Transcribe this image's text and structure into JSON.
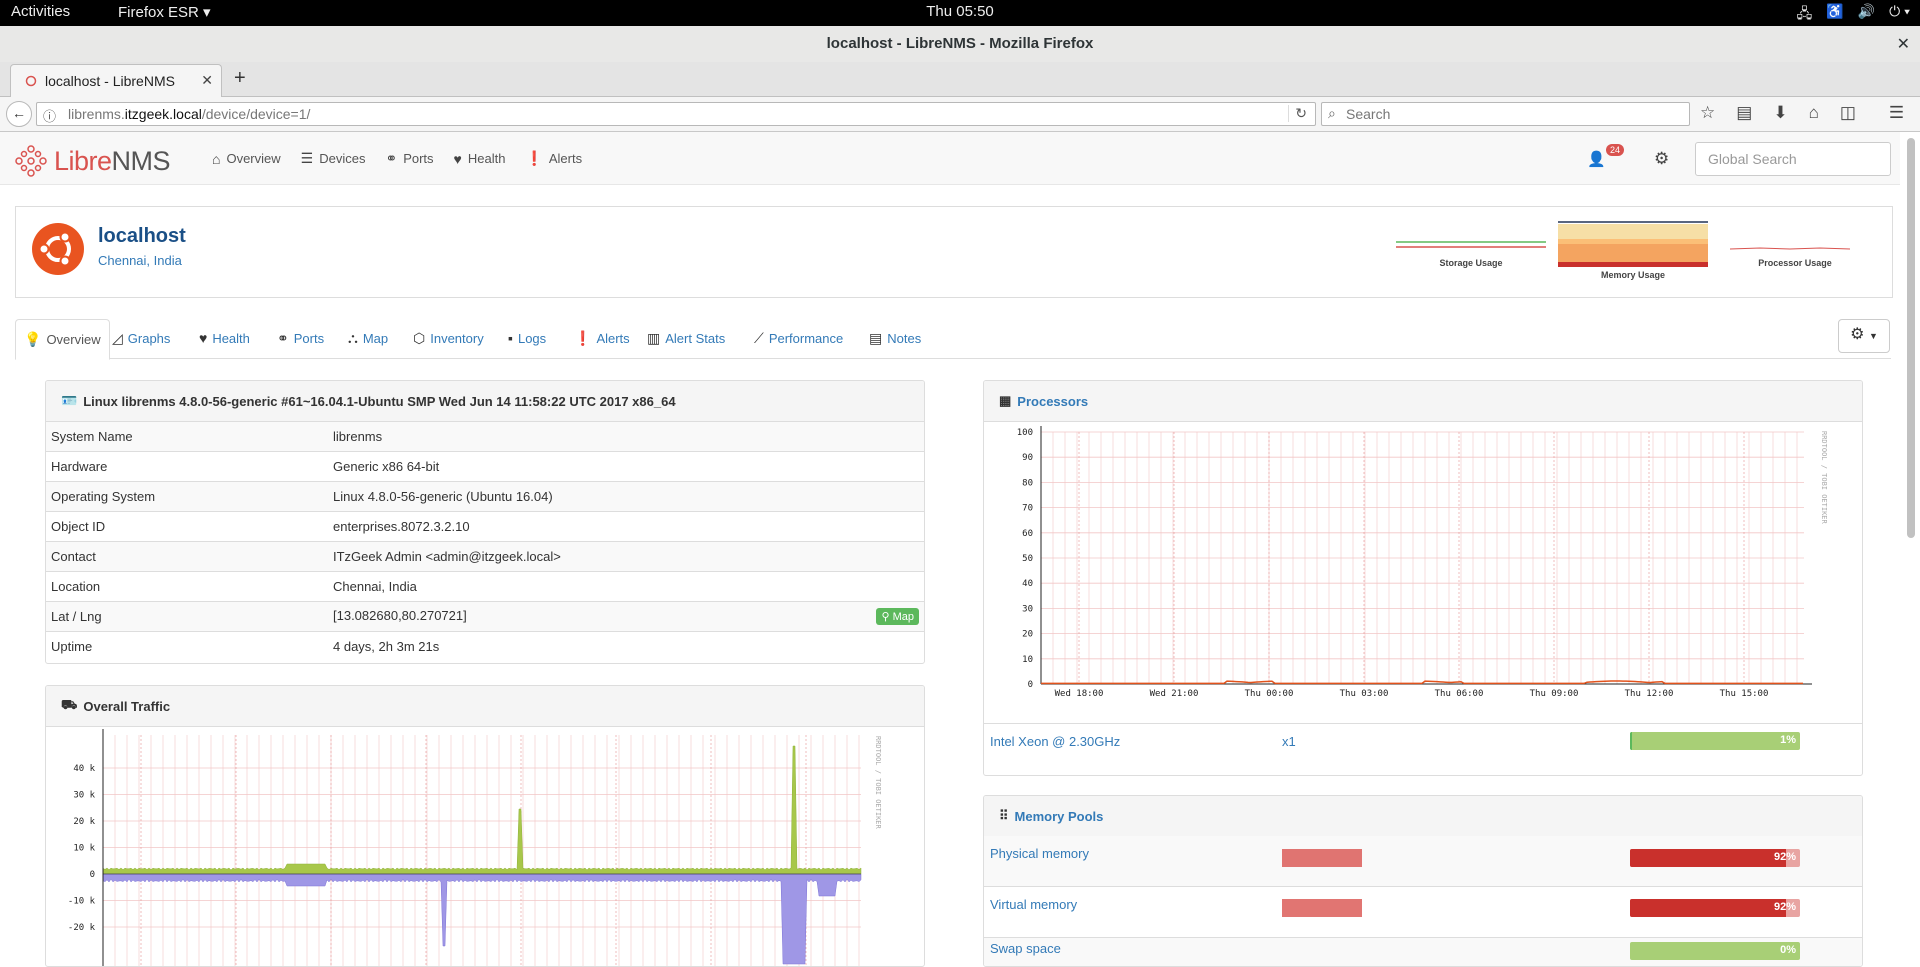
{
  "gnome": {
    "activities": "Activities",
    "app_menu": "Firefox ESR",
    "clock": "Thu 05:50"
  },
  "firefox": {
    "window_title": "localhost - LibreNMS - Mozilla Firefox",
    "tab_title": "localhost - LibreNMS",
    "url_prefix": "librenms.",
    "url_domain": "itzgeek.local",
    "url_path": "/device/device=1/",
    "search_placeholder": "Search"
  },
  "nav": {
    "logo_libre": "Libre",
    "logo_nms": "NMS",
    "items": [
      {
        "label": "Overview",
        "icon": "home-icon"
      },
      {
        "label": "Devices",
        "icon": "server-icon"
      },
      {
        "label": "Ports",
        "icon": "link-icon"
      },
      {
        "label": "Health",
        "icon": "heartbeat-icon"
      },
      {
        "label": "Alerts",
        "icon": "exclamation-circle-icon"
      }
    ],
    "notification_count": "24",
    "global_search_placeholder": "Global Search"
  },
  "device": {
    "hostname": "localhost",
    "location": "Chennai, India",
    "mini_graphs": [
      {
        "caption": "Storage Usage"
      },
      {
        "caption": "Memory Usage"
      },
      {
        "caption": "Processor Usage"
      }
    ]
  },
  "tabs": [
    {
      "label": "Overview",
      "icon": "lightbulb-icon"
    },
    {
      "label": "Graphs",
      "icon": "area-chart-icon"
    },
    {
      "label": "Health",
      "icon": "heartbeat-icon"
    },
    {
      "label": "Ports",
      "icon": "link-icon"
    },
    {
      "label": "Map",
      "icon": "sitemap-icon"
    },
    {
      "label": "Inventory",
      "icon": "cube-icon"
    },
    {
      "label": "Logs",
      "icon": "sticky-note-icon"
    },
    {
      "label": "Alerts",
      "icon": "exclamation-circle-icon"
    },
    {
      "label": "Alert Stats",
      "icon": "bar-chart-icon"
    },
    {
      "label": "Performance",
      "icon": "line-chart-icon"
    },
    {
      "label": "Notes",
      "icon": "file-text-icon"
    }
  ],
  "system": {
    "title": "Linux librenms 4.8.0-56-generic #61~16.04.1-Ubuntu SMP Wed Jun 14 11:58:22 UTC 2017 x86_64",
    "rows": [
      {
        "key": "System Name",
        "value": "librenms"
      },
      {
        "key": "Hardware",
        "value": "Generic x86 64-bit"
      },
      {
        "key": "Operating System",
        "value": "Linux 4.8.0-56-generic (Ubuntu 16.04)"
      },
      {
        "key": "Object ID",
        "value": "enterprises.8072.3.2.10"
      },
      {
        "key": "Contact",
        "value": "ITzGeek Admin <admin@itzgeek.local>"
      },
      {
        "key": "Location",
        "value": "Chennai, India"
      },
      {
        "key": "Lat / Lng",
        "value": "[13.082680,80.270721]"
      },
      {
        "key": "Uptime",
        "value": "4 days, 2h 3m 21s"
      }
    ],
    "map_button": "Map"
  },
  "traffic": {
    "title": "Overall Traffic",
    "y_ticks": [
      "40 k",
      "30 k",
      "20 k",
      "10 k",
      "0",
      "-10 k",
      "-20 k"
    ],
    "side_label": "RRDTOOL / TOBI OETIKER"
  },
  "processors": {
    "title": "Processors",
    "y_ticks": [
      "100",
      "90",
      "80",
      "70",
      "60",
      "50",
      "40",
      "30",
      "20",
      "10",
      "0"
    ],
    "x_ticks": [
      "Wed 18:00",
      "Wed 21:00",
      "Thu 00:00",
      "Thu 03:00",
      "Thu 06:00",
      "Thu 09:00",
      "Thu 12:00",
      "Thu 15:00"
    ],
    "side_label": "RRDTOOL / TOBI OETIKER",
    "cpu_name": "Intel Xeon @ 2.30GHz",
    "cpu_count": "x1",
    "cpu_usage_label": "1%",
    "cpu_usage": 1
  },
  "mempools": {
    "title": "Memory Pools",
    "rows": [
      {
        "name": "Physical memory",
        "usage_label": "92%",
        "usage": 92
      },
      {
        "name": "Virtual memory",
        "usage_label": "92%",
        "usage": 92
      },
      {
        "name": "Swap space",
        "usage_label": "0%",
        "usage": 0
      }
    ]
  },
  "colors": {
    "accent": "#337ab7",
    "danger": "#d9534f",
    "success": "#5cb85c",
    "bar_red": "#c9302c",
    "bar_green": "#a8cf76"
  }
}
